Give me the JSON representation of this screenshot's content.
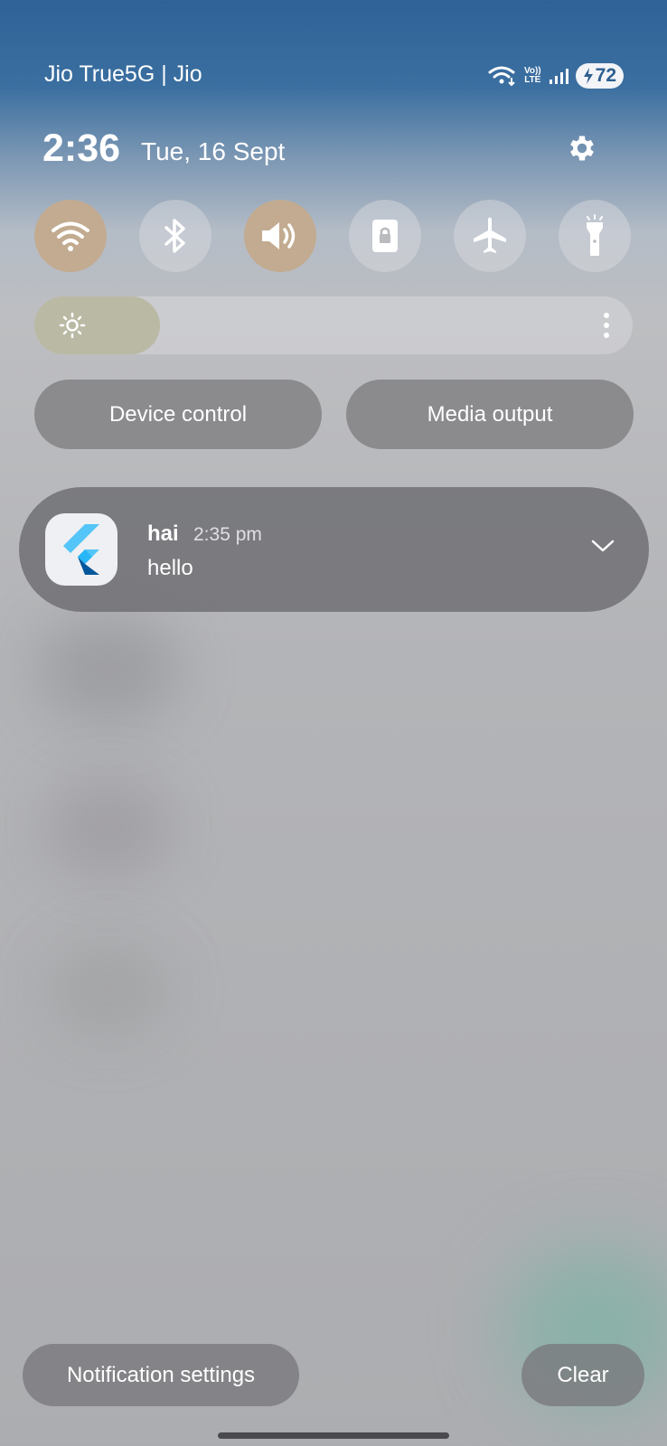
{
  "status_bar": {
    "carrier": "Jio True5G | Jio",
    "volte_top": "Vo))",
    "volte_bottom": "LTE",
    "battery": "72"
  },
  "header": {
    "time": "2:36",
    "date": "Tue, 16 Sept"
  },
  "quick_settings": {
    "tiles": [
      {
        "name": "wifi",
        "active": true
      },
      {
        "name": "bluetooth",
        "active": false
      },
      {
        "name": "sound",
        "active": true
      },
      {
        "name": "screen-lock",
        "active": false
      },
      {
        "name": "airplane-mode",
        "active": false
      },
      {
        "name": "flashlight",
        "active": false
      }
    ],
    "brightness_fraction": 0.21
  },
  "buttons": {
    "device_control": "Device control",
    "media_output": "Media output"
  },
  "notification": {
    "app_icon": "flutter-icon",
    "title": "hai",
    "time": "2:35 pm",
    "body": "hello"
  },
  "footer": {
    "notification_settings": "Notification settings",
    "clear": "Clear"
  },
  "colors": {
    "active_tile": "#c2ab90",
    "brightness_fill": "#bab9a4"
  }
}
